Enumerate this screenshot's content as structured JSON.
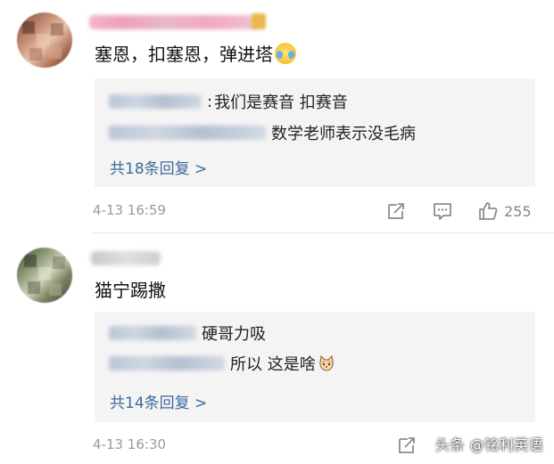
{
  "comments": [
    {
      "text": "塞恩，扣塞恩，弹进塔",
      "emoji": "crying-laughing-emoji",
      "replies": [
        {
          "separator": ":",
          "text": "我们是赛音 扣赛音"
        },
        {
          "separator": "",
          "text": "数学老师表示没毛病"
        }
      ],
      "more_replies": "共18条回复 >",
      "timestamp": "4-13 16:59",
      "like_count": "255"
    },
    {
      "text": "猫宁踢撒",
      "replies": [
        {
          "separator": "",
          "text": "硬哥力吸"
        },
        {
          "separator": "",
          "text": "所以 这是啥",
          "emoji": "cat-emoji"
        }
      ],
      "more_replies": "共14条回复 >",
      "timestamp": "4-13 16:30"
    }
  ],
  "watermark": "头条 @铭利英语",
  "icons": {
    "repost": "repost-icon",
    "comment": "comment-icon",
    "like": "thumbs-up-icon"
  },
  "colors": {
    "link": "#3d6a9c",
    "timestamp": "#9a9a9a",
    "reply_bg": "#f4f4f4"
  }
}
